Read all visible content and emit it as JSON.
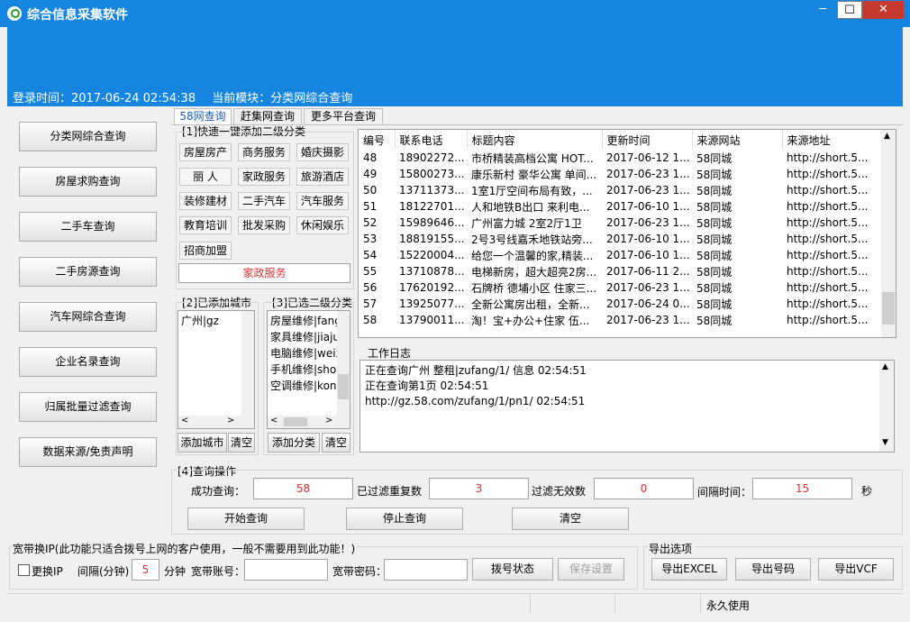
{
  "window": {
    "title": "综合信息采集软件",
    "min": "─",
    "max": "☐",
    "close": "✕"
  },
  "header": {
    "login_label": "登录时间：",
    "login_time": "2017-06-24 02:54:38",
    "module_label": "当前模块：",
    "module": "分类网综合查询"
  },
  "sidebar": {
    "items": [
      {
        "label": "分类网综合查询"
      },
      {
        "label": "房屋求购查询"
      },
      {
        "label": "二手车查询"
      },
      {
        "label": "二手房源查询"
      },
      {
        "label": "汽车网综合查询"
      },
      {
        "label": "企业名录查询"
      },
      {
        "label": "归属批量过滤查询"
      },
      {
        "label": "数据来源/免责声明"
      }
    ]
  },
  "tabs": [
    {
      "label": "58网查询"
    },
    {
      "label": "赶集网查询"
    },
    {
      "label": "更多平台查询"
    }
  ],
  "quick": {
    "title": "[1]快速一键添加二级分类",
    "categories": [
      "房屋房产",
      "商务服务",
      "婚庆摄影",
      "丽 人",
      "家政服务",
      "旅游酒店",
      "装修建材",
      "二手汽车",
      "汽车服务",
      "教育培训",
      "批发采购",
      "休闲娱乐",
      "招商加盟"
    ],
    "selected": "家政服务"
  },
  "cities": {
    "title": "[2]已添加城市",
    "items": [
      "广州|gz"
    ],
    "add_btn": "添加城市",
    "clear_btn": "清空"
  },
  "subcats": {
    "title": "[3]已选二级分类",
    "items": [
      "房屋维修|fang",
      "家具维修|jiaju",
      "电脑维修|weix",
      "手机维修|shou",
      "空调维修|kon"
    ],
    "add_btn": "添加分类",
    "clear_btn": "清空"
  },
  "grid": {
    "columns": [
      "编号",
      "联系电话",
      "标题内容",
      "更新时间",
      "来源网站",
      "来源地址"
    ],
    "rows": [
      [
        "48",
        "18902272...",
        "市桥精装高档公寓 HOT...",
        "2017-06-12 1...",
        "58同城",
        "http://short.5..."
      ],
      [
        "49",
        "15800273...",
        "康乐新村 豪华公寓 单间...",
        "2017-06-23 1...",
        "58同城",
        "http://short.5..."
      ],
      [
        "50",
        "13711373...",
        "1室1厅空间布局有致，...",
        "2017-06-23 1...",
        "58同城",
        "http://short.5..."
      ],
      [
        "51",
        "18122701...",
        "人和地铁B出口 来利电...",
        "2017-06-10 1...",
        "58同城",
        "http://short.5..."
      ],
      [
        "52",
        "15989646...",
        "广州富力城 2室2厅1卫",
        "2017-06-23 1...",
        "58同城",
        "http://short.5..."
      ],
      [
        "53",
        "18819155...",
        "2号3号线嘉禾地铁站旁...",
        "2017-06-10 1...",
        "58同城",
        "http://short.5..."
      ],
      [
        "54",
        "15220004...",
        "给您一个温馨的家,精装...",
        "2017-06-10 1...",
        "58同城",
        "http://short.5..."
      ],
      [
        "55",
        "13710878...",
        "电梯新房，超大超亮2房...",
        "2017-06-11 2...",
        "58同城",
        "http://short.5..."
      ],
      [
        "56",
        "17620192...",
        "石牌桥 德埔小区 住家三...",
        "2017-06-23 1...",
        "58同城",
        "http://short.5..."
      ],
      [
        "57",
        "13925077...",
        "全新公寓房出租，全新...",
        "2017-06-24 0...",
        "58同城",
        "http://short.5..."
      ],
      [
        "58",
        "13790011...",
        "淘！宝+办公+住家 伍...",
        "2017-06-23 1...",
        "58同城",
        "http://short.5..."
      ]
    ]
  },
  "log": {
    "title": "工作日志",
    "lines": [
      "正在查询广州 整租|zufang/1/ 信息    02:54:51",
      "正在查询第1页    02:54:51",
      "http://gz.58.com/zufang/1/pn1/  02:54:51"
    ]
  },
  "query": {
    "title": "[4]查询操作",
    "success_label": "成功查询：",
    "success": "58",
    "dup_label": "已过滤重复数",
    "dup": "3",
    "invalid_label": "过滤无效数",
    "invalid": "0",
    "interval_label": "间隔时间：",
    "interval": "15",
    "interval_unit": "秒",
    "start_btn": "开始查询",
    "stop_btn": "停止查询",
    "clear_btn": "清空"
  },
  "broadband": {
    "title": "宽带换IP(此功能只适合拨号上网的客户使用，一般不需要用到此功能！)",
    "change_ip": "更换IP",
    "interval_label": "间隔(分钟)",
    "interval": "5",
    "interval_unit": "分钟",
    "account_label": "宽带账号：",
    "password_label": "宽带密码：",
    "dial_btn": "拨号状态",
    "save_btn": "保存设置"
  },
  "export": {
    "title": "导出选项",
    "excel_btn": "导出EXCEL",
    "phone_btn": "导出号码",
    "vcf_btn": "导出VCF"
  },
  "statusbar": {
    "license": "永久使用"
  },
  "colors": {
    "accent": "#1685e0",
    "value_red": "#e03030"
  }
}
